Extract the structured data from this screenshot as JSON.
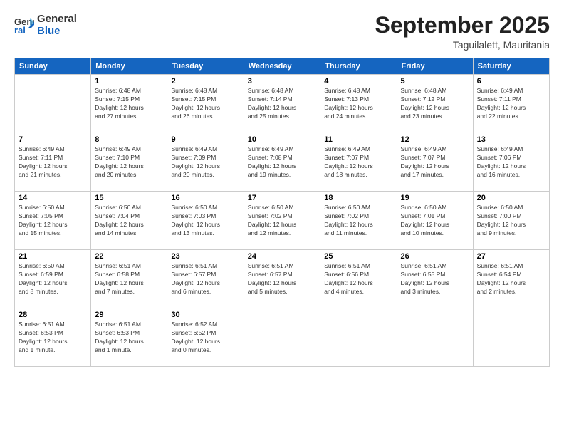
{
  "header": {
    "logo_line1": "General",
    "logo_line2": "Blue",
    "month": "September 2025",
    "location": "Taguilalett, Mauritania"
  },
  "days_of_week": [
    "Sunday",
    "Monday",
    "Tuesday",
    "Wednesday",
    "Thursday",
    "Friday",
    "Saturday"
  ],
  "weeks": [
    [
      {
        "day": "",
        "info": ""
      },
      {
        "day": "1",
        "info": "Sunrise: 6:48 AM\nSunset: 7:15 PM\nDaylight: 12 hours\nand 27 minutes."
      },
      {
        "day": "2",
        "info": "Sunrise: 6:48 AM\nSunset: 7:15 PM\nDaylight: 12 hours\nand 26 minutes."
      },
      {
        "day": "3",
        "info": "Sunrise: 6:48 AM\nSunset: 7:14 PM\nDaylight: 12 hours\nand 25 minutes."
      },
      {
        "day": "4",
        "info": "Sunrise: 6:48 AM\nSunset: 7:13 PM\nDaylight: 12 hours\nand 24 minutes."
      },
      {
        "day": "5",
        "info": "Sunrise: 6:48 AM\nSunset: 7:12 PM\nDaylight: 12 hours\nand 23 minutes."
      },
      {
        "day": "6",
        "info": "Sunrise: 6:49 AM\nSunset: 7:11 PM\nDaylight: 12 hours\nand 22 minutes."
      }
    ],
    [
      {
        "day": "7",
        "info": "Sunrise: 6:49 AM\nSunset: 7:11 PM\nDaylight: 12 hours\nand 21 minutes."
      },
      {
        "day": "8",
        "info": "Sunrise: 6:49 AM\nSunset: 7:10 PM\nDaylight: 12 hours\nand 20 minutes."
      },
      {
        "day": "9",
        "info": "Sunrise: 6:49 AM\nSunset: 7:09 PM\nDaylight: 12 hours\nand 20 minutes."
      },
      {
        "day": "10",
        "info": "Sunrise: 6:49 AM\nSunset: 7:08 PM\nDaylight: 12 hours\nand 19 minutes."
      },
      {
        "day": "11",
        "info": "Sunrise: 6:49 AM\nSunset: 7:07 PM\nDaylight: 12 hours\nand 18 minutes."
      },
      {
        "day": "12",
        "info": "Sunrise: 6:49 AM\nSunset: 7:07 PM\nDaylight: 12 hours\nand 17 minutes."
      },
      {
        "day": "13",
        "info": "Sunrise: 6:49 AM\nSunset: 7:06 PM\nDaylight: 12 hours\nand 16 minutes."
      }
    ],
    [
      {
        "day": "14",
        "info": "Sunrise: 6:50 AM\nSunset: 7:05 PM\nDaylight: 12 hours\nand 15 minutes."
      },
      {
        "day": "15",
        "info": "Sunrise: 6:50 AM\nSunset: 7:04 PM\nDaylight: 12 hours\nand 14 minutes."
      },
      {
        "day": "16",
        "info": "Sunrise: 6:50 AM\nSunset: 7:03 PM\nDaylight: 12 hours\nand 13 minutes."
      },
      {
        "day": "17",
        "info": "Sunrise: 6:50 AM\nSunset: 7:02 PM\nDaylight: 12 hours\nand 12 minutes."
      },
      {
        "day": "18",
        "info": "Sunrise: 6:50 AM\nSunset: 7:02 PM\nDaylight: 12 hours\nand 11 minutes."
      },
      {
        "day": "19",
        "info": "Sunrise: 6:50 AM\nSunset: 7:01 PM\nDaylight: 12 hours\nand 10 minutes."
      },
      {
        "day": "20",
        "info": "Sunrise: 6:50 AM\nSunset: 7:00 PM\nDaylight: 12 hours\nand 9 minutes."
      }
    ],
    [
      {
        "day": "21",
        "info": "Sunrise: 6:50 AM\nSunset: 6:59 PM\nDaylight: 12 hours\nand 8 minutes."
      },
      {
        "day": "22",
        "info": "Sunrise: 6:51 AM\nSunset: 6:58 PM\nDaylight: 12 hours\nand 7 minutes."
      },
      {
        "day": "23",
        "info": "Sunrise: 6:51 AM\nSunset: 6:57 PM\nDaylight: 12 hours\nand 6 minutes."
      },
      {
        "day": "24",
        "info": "Sunrise: 6:51 AM\nSunset: 6:57 PM\nDaylight: 12 hours\nand 5 minutes."
      },
      {
        "day": "25",
        "info": "Sunrise: 6:51 AM\nSunset: 6:56 PM\nDaylight: 12 hours\nand 4 minutes."
      },
      {
        "day": "26",
        "info": "Sunrise: 6:51 AM\nSunset: 6:55 PM\nDaylight: 12 hours\nand 3 minutes."
      },
      {
        "day": "27",
        "info": "Sunrise: 6:51 AM\nSunset: 6:54 PM\nDaylight: 12 hours\nand 2 minutes."
      }
    ],
    [
      {
        "day": "28",
        "info": "Sunrise: 6:51 AM\nSunset: 6:53 PM\nDaylight: 12 hours\nand 1 minute."
      },
      {
        "day": "29",
        "info": "Sunrise: 6:51 AM\nSunset: 6:53 PM\nDaylight: 12 hours\nand 1 minute."
      },
      {
        "day": "30",
        "info": "Sunrise: 6:52 AM\nSunset: 6:52 PM\nDaylight: 12 hours\nand 0 minutes."
      },
      {
        "day": "",
        "info": ""
      },
      {
        "day": "",
        "info": ""
      },
      {
        "day": "",
        "info": ""
      },
      {
        "day": "",
        "info": ""
      }
    ]
  ]
}
